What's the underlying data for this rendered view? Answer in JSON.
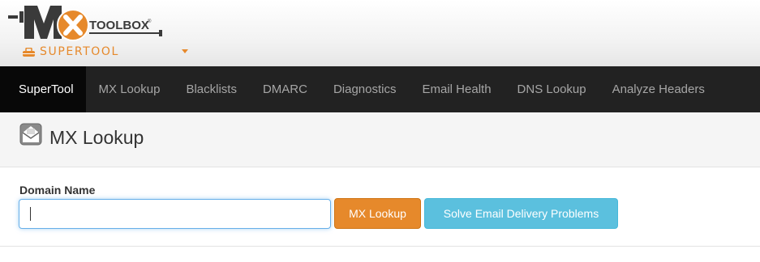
{
  "brand": {
    "logo_letters": "MX",
    "logo_wordmark": "TOOLBOX",
    "logo_registered": "®",
    "product_label": "SUPERTOOL",
    "accent_color": "#e6892b",
    "icons": [
      "mx-toolbox-logo",
      "toolbox-icon",
      "caret-down-icon"
    ]
  },
  "nav": {
    "items": [
      {
        "label": "SuperTool",
        "active": true
      },
      {
        "label": "MX Lookup",
        "active": false
      },
      {
        "label": "Blacklists",
        "active": false
      },
      {
        "label": "DMARC",
        "active": false
      },
      {
        "label": "Diagnostics",
        "active": false
      },
      {
        "label": "Email Health",
        "active": false
      },
      {
        "label": "DNS Lookup",
        "active": false
      },
      {
        "label": "Analyze Headers",
        "active": false
      }
    ]
  },
  "page": {
    "title": "MX Lookup",
    "title_icon": "envelope-icon"
  },
  "form": {
    "domain_label": "Domain Name",
    "domain_value": "",
    "domain_placeholder": "",
    "lookup_button": "MX Lookup",
    "lookup_button_color": "#e6892b",
    "solve_button": "Solve Email Delivery Problems",
    "solve_button_color": "#5bc0de"
  }
}
